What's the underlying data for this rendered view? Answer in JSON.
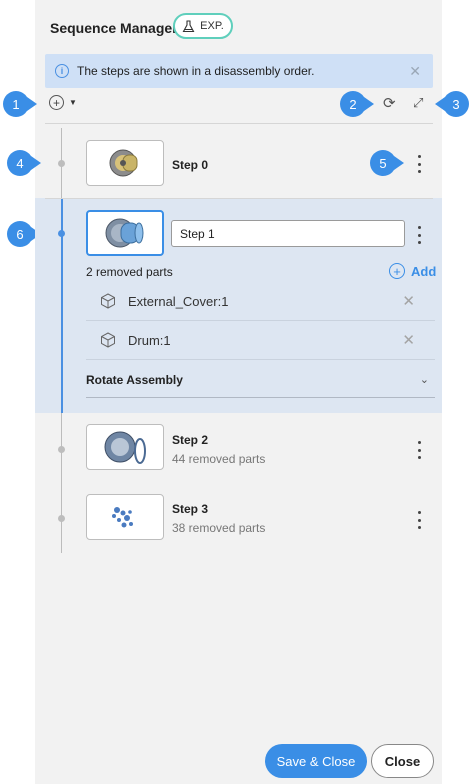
{
  "header": {
    "title": "Sequence Manager",
    "badge_label": "EXP."
  },
  "info_bar": {
    "message": "The steps are shown in a disassembly order."
  },
  "callouts": [
    "1",
    "2",
    "3",
    "4",
    "5",
    "6"
  ],
  "steps": [
    {
      "label": "Step 0"
    },
    {
      "label": "Step 1",
      "input_value": "Step 1",
      "removed_count": "2 removed parts",
      "parts": [
        {
          "name": "External_Cover:1"
        },
        {
          "name": "Drum:1"
        }
      ],
      "add_label": "Add",
      "action": "Rotate Assembly"
    },
    {
      "label": "Step 2",
      "subtitle": "44 removed parts"
    },
    {
      "label": "Step 3",
      "subtitle": "38 removed parts"
    }
  ],
  "footer": {
    "save_label": "Save & Close",
    "close_label": "Close"
  },
  "colors": {
    "accent": "#3a8ee6",
    "badge_border": "#5fcfbc",
    "info_bg": "#cfe0f6",
    "active_bg": "#dde6f2"
  }
}
